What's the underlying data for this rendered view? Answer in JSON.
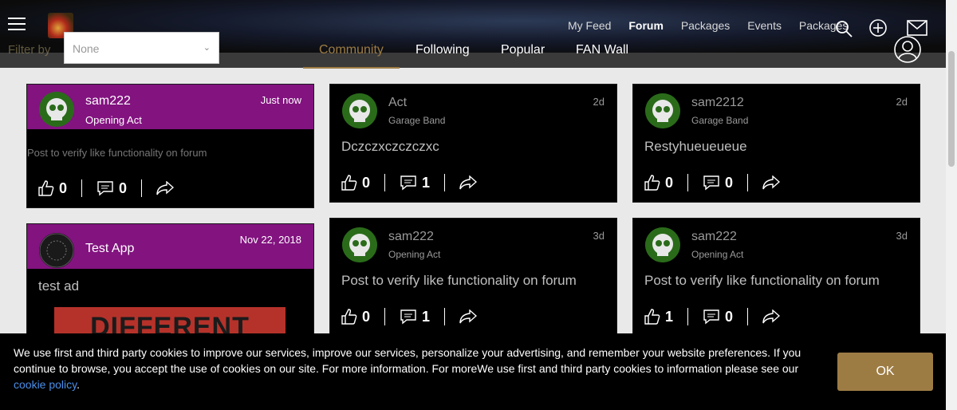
{
  "header": {
    "nav": [
      "My Feed",
      "Forum",
      "Packages",
      "Events",
      "Packages"
    ],
    "active_nav_index": 1,
    "filter_label": "Filter by",
    "filter_value": "None",
    "tabs": [
      "Community",
      "Following",
      "Popular",
      "FAN Wall"
    ],
    "active_tab_index": 0,
    "icons": [
      "menu-icon",
      "search-icon",
      "plus-circle-icon",
      "mail-icon",
      "user-icon"
    ]
  },
  "colors": {
    "accent": "#9d7c44",
    "highlight": "#82137f",
    "link": "#4a8fe8"
  },
  "cards": [
    {
      "name": "sam222",
      "role": "Opening Act",
      "time": "Just now",
      "text": "Post to verify like functionality on forum",
      "likes": "0",
      "comments": "0"
    },
    {
      "name": "Test App",
      "time": "Nov 22, 2018",
      "text": "test ad",
      "image_text": "DIFFERENT"
    },
    {
      "name": "Act",
      "role": "Garage Band",
      "time": "2d",
      "text": "Dczczxczczczxc",
      "likes": "0",
      "comments": "1"
    },
    {
      "name": "sam2212",
      "role": "Garage Band",
      "time": "2d",
      "text": "Restyhueueueue",
      "likes": "0",
      "comments": "0"
    },
    {
      "name": "sam222",
      "role": "Opening Act",
      "time": "3d",
      "text": "Post to verify like functionality on forum",
      "likes": "0",
      "comments": "1"
    },
    {
      "name": "sam222",
      "role": "Opening Act",
      "time": "3d",
      "text": "Post to verify like functionality on forum",
      "likes": "1",
      "comments": "0"
    }
  ],
  "cookie": {
    "text": "We use first and third party cookies to improve our services, improve our services, personalize your advertising, and remember your website preferences. If you continue to browse, you accept the use of cookies on our site. For more information. For moreWe use first and third party cookies to information please see our",
    "link": "cookie policy",
    "after_link": ".",
    "ok": "OK"
  }
}
